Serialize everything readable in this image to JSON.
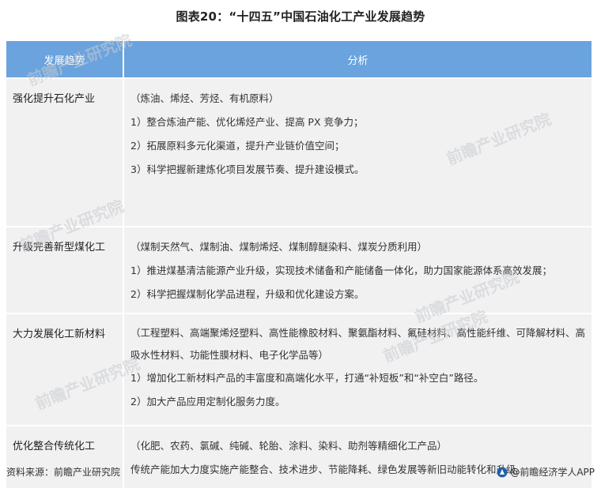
{
  "title": "图表20：“十四五”中国石油化工产业发展趋势",
  "table": {
    "headers": [
      "发展趋势",
      "分析"
    ],
    "rows": [
      {
        "topic": "强化提升石化产业",
        "lines": [
          "（炼油、烯烃、芳烃、有机原料）",
          "1）整合炼油产能、优化烯烃产业、提高 PX 竞争力；",
          "2）拓展原料多元化渠道，提升产业链价值空间；",
          "3）科学把握新建炼化项目发展节奏、提升建设模式。"
        ]
      },
      {
        "topic": "升级完善新型煤化工",
        "lines": [
          "（煤制天然气、煤制油、煤制烯烃、煤制醇醚染料、煤炭分质利用）",
          "1）推进煤基清洁能源产业升级，实现技术储备和产能储备一体化，助力国家能源体系高效发展；",
          "2）科学把握煤制化学品进程，升级和优化建设方案。"
        ]
      },
      {
        "topic": "大力发展化工新材料",
        "lines": [
          "（工程塑料、高端聚烯烃塑料、高性能橡胶材料、聚氨酯材料、氟硅材料、高性能纤维、可降解材料、高吸水性材料、功能性膜材料、电子化学品等）",
          "1）增加化工新材料产品的丰富度和高端化水平，打通“补短板”和“补空白”路径。",
          "2）加大产品应用定制化服务力度。"
        ]
      },
      {
        "topic": "优化整合传统化工",
        "lines": [
          "（化肥、农药、氯碱、纯碱、轮胎、涂料、染料、助剂等精细化工产品）",
          "传统产能加大力度实施产能整合、技术进步、节能降耗、绿色发展等新旧动能转化和升级。"
        ]
      }
    ]
  },
  "footer": {
    "source": "资料来源：前瞻产业研究院",
    "brand": "@前瞻经济学人APP"
  },
  "watermark": "前瞻产业研究院",
  "colors": {
    "header_bg": "#6aa3de",
    "row_bg": "#f1f1f2",
    "logo_blue": "#1f5fa8"
  }
}
